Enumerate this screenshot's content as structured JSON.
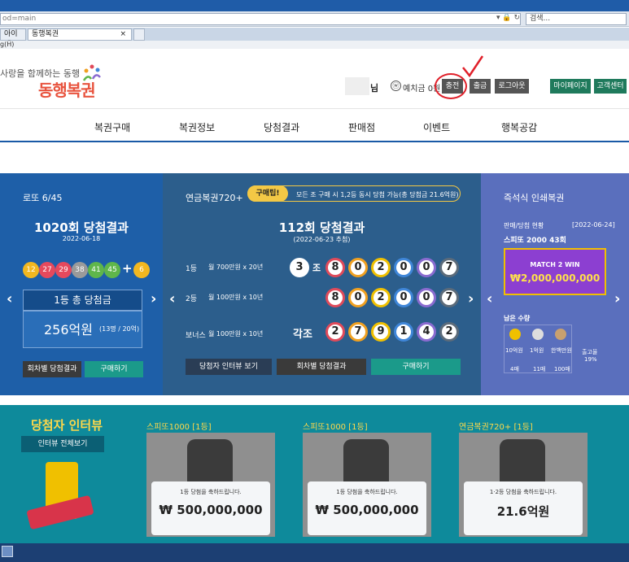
{
  "browser": {
    "url": "od=main",
    "search_placeholder": "검색...",
    "tab1": "아이패...",
    "tab2": "동행복권",
    "tab_close": "×",
    "menu_hint": "g(H)"
  },
  "header": {
    "slogan": "사랑을 함께하는 동행",
    "logo": "동행복권",
    "user_suffix": "님",
    "deposit_icon": "ⓦ",
    "deposit_label": "예치금 0원",
    "charge_btn": "충전",
    "withdraw_btn": "출금",
    "logout_btn": "로그아웃",
    "mypage_btn": "마이페이지",
    "support_btn": "고객센터"
  },
  "nav": [
    "복권구매",
    "복권정보",
    "당첨결과",
    "판매점",
    "이벤트",
    "행복공감"
  ],
  "lotto": {
    "title": "로또 6/45",
    "round": "1020회 당첨결과",
    "date": "2022-06-18",
    "balls": [
      "12",
      "27",
      "29",
      "38",
      "41",
      "45"
    ],
    "plus": "+",
    "bonus": "6",
    "prize_label": "1등 총 당첨금",
    "prize_amount": "256억원",
    "prize_detail": "(13명 / 20억)",
    "btn_results": "회차별 당첨결과",
    "btn_buy": "구매하기"
  },
  "pension": {
    "title": "연금복권720+",
    "tip_badge": "구매팁!",
    "tip_text": "모든 조 구매 시 1,2등 동시 당첨 가능(총 당첨금 21.6억원)",
    "round": "112회 당첨결과",
    "date": "(2022-06-23 추첨)",
    "rank1_label": "1등",
    "rank1_desc": "월 700만원 x 20년",
    "rank1_group": "3",
    "jo": "조",
    "digits": [
      "8",
      "0",
      "2",
      "0",
      "0",
      "7"
    ],
    "rank2_label": "2등",
    "rank2_desc": "월 100만원 x 10년",
    "bonus_label": "보너스",
    "bonus_desc": "월 100만원 x 10년",
    "bonus_group": "각조",
    "bonus_digits": [
      "2",
      "7",
      "9",
      "1",
      "4",
      "2"
    ],
    "btn_interview": "당첨자 인터뷰 보기",
    "btn_results": "회차별 당첨결과",
    "btn_buy": "구매하기"
  },
  "instant": {
    "title": "즉석식 인쇄복권",
    "status_label": "판매/당첨 현황",
    "status_date": "[2022-06-24]",
    "game": "스피또 2000 43회",
    "banner_text": "MATCH 2 WIN",
    "banner_amount": "₩2,000,000,000",
    "remaining_label": "남은 수량",
    "col_prize": [
      "10억원",
      "1억원",
      "한백만원"
    ],
    "col_count": [
      "4매",
      "11매",
      "100매"
    ],
    "stock_label": "출고율",
    "stock_rate": "19%"
  },
  "interview": {
    "title": "당첨자 인터뷰",
    "all_btn": "인터뷰 전체보기",
    "stories": [
      {
        "label": "스피또1000 [1등]",
        "msg": "1등 당첨을 축하드립니다.",
        "amount": "₩ 500,000,000"
      },
      {
        "label": "스피또1000 [1등]",
        "msg": "1등 당첨을 축하드립니다.",
        "amount": "₩ 500,000,000"
      },
      {
        "label": "연금복권720+ [1등]",
        "msg": "1·2등 당첨을 축하드립니다.",
        "amount": "21.6억원"
      }
    ]
  },
  "colors": {
    "ball_yellow": "#f2b720",
    "ball_blue": "#3e8ed8",
    "ball_red": "#e5495d",
    "ball_gray": "#9a9a9a",
    "ball_green": "#5fb64a",
    "pension_ring": [
      "#e04a5a",
      "#f0a020",
      "#f0c000",
      "#3f86d8",
      "#8a6bd0",
      "#5c6b7a"
    ]
  }
}
